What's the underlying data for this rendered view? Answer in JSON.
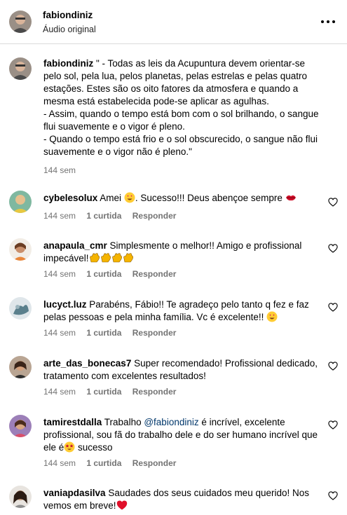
{
  "header": {
    "username": "fabiondiniz",
    "subtitle": "Áudio original"
  },
  "caption": {
    "username": "fabiondiniz",
    "text": " \" - Todas as leis da Acupuntura devem orientar-se pelo sol, pela lua, pelos planetas, pelas estrelas e pelas quatro estações. Estes são os oito fatores da atmosfera e quando a mesma está estabelecida pode-se aplicar as agulhas.\n- Assim, quando o tempo está bom com o sol brilhando, o sangue flui suavemente e o vigor é pleno.\n- Quando o tempo está frio e o sol obscurecido, o sangue não flui suavemente e o vigor não é pleno.\"",
    "time": "144 sem"
  },
  "comments": [
    {
      "username": "cybelesolux",
      "text_a": " Amei ",
      "text_b": ". Sucesso!!! Deus abençoe sempre ",
      "time": "144 sem",
      "likes": "1 curtida",
      "reply": "Responder"
    },
    {
      "username": "anapaula_cmr",
      "text_a": " Simplesmente o melhor!! Amigo e profissional impecável!",
      "time": "144 sem",
      "likes": "1 curtida",
      "reply": "Responder"
    },
    {
      "username": "lucyct.luz",
      "text_a": " Parabéns, Fábio!! Te agradeço pelo tanto q fez e faz pelas pessoas e pela minha família. Vc é excelente!! ",
      "time": "144 sem",
      "likes": "1 curtida",
      "reply": "Responder"
    },
    {
      "username": "arte_das_bonecas7",
      "text_a": " Super recomendado! Profissional dedicado, tratamento com excelentes resultados!",
      "time": "144 sem",
      "likes": "1 curtida",
      "reply": "Responder"
    },
    {
      "username": "tamirestdalla",
      "text_a": " Trabalho ",
      "mention": "@fabiondiniz",
      "text_b": " é incrível, excelente profissional, sou fã do trabalho dele e do ser humano incrível que ele é",
      "text_c": " sucesso",
      "time": "144 sem",
      "likes": "1 curtida",
      "reply": "Responder"
    },
    {
      "username": "vaniapdasilva",
      "text_a": " Saudades dos seus cuidados meu querido! Nos vemos em breve!"
    }
  ],
  "icons": {
    "more": "more-options-icon",
    "like": "heart-outline-icon",
    "heart_eyes": "heart-eyes-emoji",
    "kiss": "kiss-lips-emoji",
    "clap": "clapping-hands-emoji",
    "star_struck": "star-struck-emoji",
    "red_heart": "red-heart-emoji"
  },
  "colors": {
    "text": "#000000",
    "secondary": "#737373",
    "mention": "#00376b",
    "divider": "#dbdbdb"
  }
}
